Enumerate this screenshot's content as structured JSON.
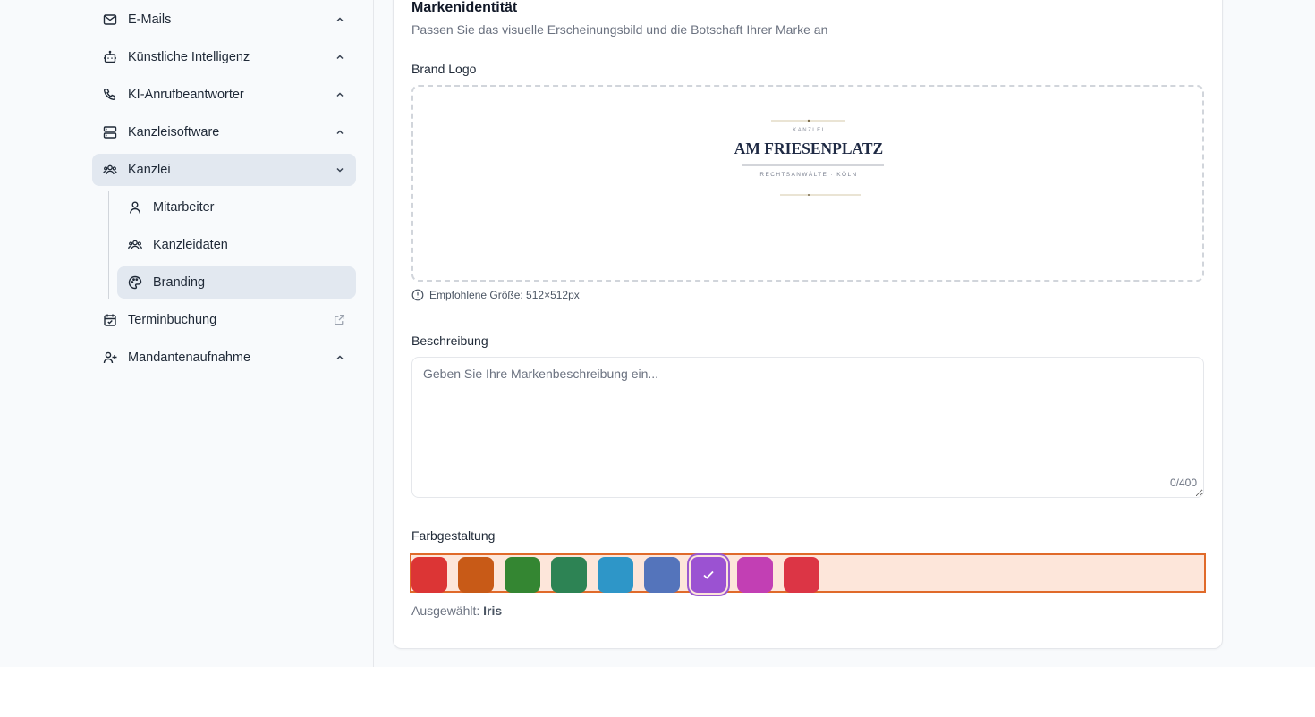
{
  "sidebar": {
    "items": [
      {
        "label": "E-Mails",
        "icon": "mail-icon"
      },
      {
        "label": "Künstliche Intelligenz",
        "icon": "bot-icon"
      },
      {
        "label": "KI-Anrufbeantworter",
        "icon": "phone-icon"
      },
      {
        "label": "Kanzleisoftware",
        "icon": "server-icon"
      },
      {
        "label": "Kanzlei",
        "icon": "users-icon"
      },
      {
        "label": "Terminbuchung",
        "icon": "calendar-icon"
      },
      {
        "label": "Mandantenaufnahme",
        "icon": "user-plus-icon"
      }
    ],
    "subitems": [
      {
        "label": "Mitarbeiter",
        "icon": "user-icon"
      },
      {
        "label": "Kanzleidaten",
        "icon": "users-icon"
      },
      {
        "label": "Branding",
        "icon": "palette-icon"
      }
    ]
  },
  "main": {
    "title": "Markenidentität",
    "subtitle": "Passen Sie das visuelle Erscheinungsbild und die Botschaft Ihrer Marke an",
    "logo_label": "Brand Logo",
    "logo": {
      "top": "KANZLEI",
      "name": "AM FRIESENPLATZ",
      "sub": "RECHTSANWÄLTE · KÖLN"
    },
    "hint": "Empfohlene Größe: 512×512px",
    "description_label": "Beschreibung",
    "description_placeholder": "Geben Sie Ihre Markenbeschreibung ein...",
    "description_value": "",
    "counter": "0/400",
    "color_label": "Farbgestaltung",
    "colors": [
      "#dc3535",
      "#c85a17",
      "#348632",
      "#2d8354",
      "#2e96c8",
      "#5474bb",
      "#9b52d2",
      "#c23fb4",
      "#dc3545"
    ],
    "selected_prefix": "Ausgewählt:",
    "selected_name": "Iris"
  },
  "accent": "#e06a2a"
}
